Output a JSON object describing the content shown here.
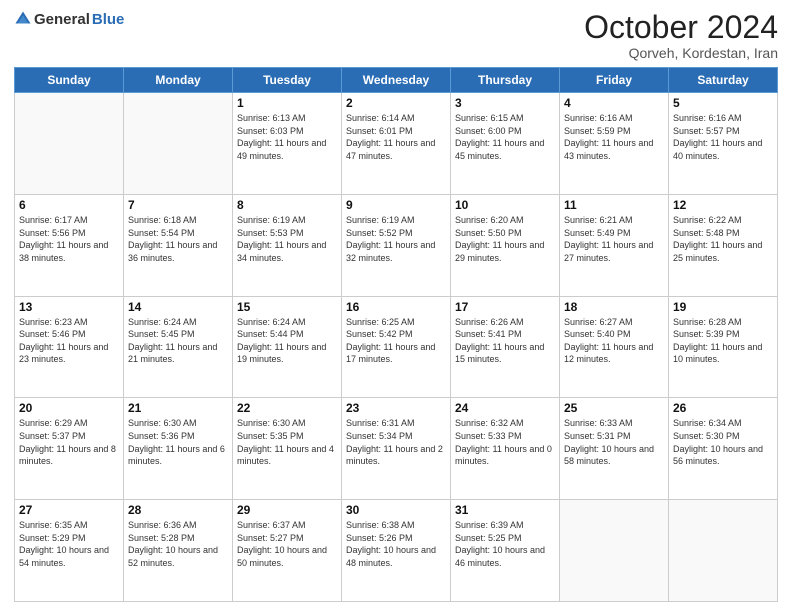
{
  "header": {
    "logo_general": "General",
    "logo_blue": "Blue",
    "title": "October 2024",
    "subtitle": "Qorveh, Kordestan, Iran"
  },
  "days_of_week": [
    "Sunday",
    "Monday",
    "Tuesday",
    "Wednesday",
    "Thursday",
    "Friday",
    "Saturday"
  ],
  "weeks": [
    [
      {
        "day": null,
        "info": null
      },
      {
        "day": null,
        "info": null
      },
      {
        "day": "1",
        "info": "Sunrise: 6:13 AM\nSunset: 6:03 PM\nDaylight: 11 hours and 49 minutes."
      },
      {
        "day": "2",
        "info": "Sunrise: 6:14 AM\nSunset: 6:01 PM\nDaylight: 11 hours and 47 minutes."
      },
      {
        "day": "3",
        "info": "Sunrise: 6:15 AM\nSunset: 6:00 PM\nDaylight: 11 hours and 45 minutes."
      },
      {
        "day": "4",
        "info": "Sunrise: 6:16 AM\nSunset: 5:59 PM\nDaylight: 11 hours and 43 minutes."
      },
      {
        "day": "5",
        "info": "Sunrise: 6:16 AM\nSunset: 5:57 PM\nDaylight: 11 hours and 40 minutes."
      }
    ],
    [
      {
        "day": "6",
        "info": "Sunrise: 6:17 AM\nSunset: 5:56 PM\nDaylight: 11 hours and 38 minutes."
      },
      {
        "day": "7",
        "info": "Sunrise: 6:18 AM\nSunset: 5:54 PM\nDaylight: 11 hours and 36 minutes."
      },
      {
        "day": "8",
        "info": "Sunrise: 6:19 AM\nSunset: 5:53 PM\nDaylight: 11 hours and 34 minutes."
      },
      {
        "day": "9",
        "info": "Sunrise: 6:19 AM\nSunset: 5:52 PM\nDaylight: 11 hours and 32 minutes."
      },
      {
        "day": "10",
        "info": "Sunrise: 6:20 AM\nSunset: 5:50 PM\nDaylight: 11 hours and 29 minutes."
      },
      {
        "day": "11",
        "info": "Sunrise: 6:21 AM\nSunset: 5:49 PM\nDaylight: 11 hours and 27 minutes."
      },
      {
        "day": "12",
        "info": "Sunrise: 6:22 AM\nSunset: 5:48 PM\nDaylight: 11 hours and 25 minutes."
      }
    ],
    [
      {
        "day": "13",
        "info": "Sunrise: 6:23 AM\nSunset: 5:46 PM\nDaylight: 11 hours and 23 minutes."
      },
      {
        "day": "14",
        "info": "Sunrise: 6:24 AM\nSunset: 5:45 PM\nDaylight: 11 hours and 21 minutes."
      },
      {
        "day": "15",
        "info": "Sunrise: 6:24 AM\nSunset: 5:44 PM\nDaylight: 11 hours and 19 minutes."
      },
      {
        "day": "16",
        "info": "Sunrise: 6:25 AM\nSunset: 5:42 PM\nDaylight: 11 hours and 17 minutes."
      },
      {
        "day": "17",
        "info": "Sunrise: 6:26 AM\nSunset: 5:41 PM\nDaylight: 11 hours and 15 minutes."
      },
      {
        "day": "18",
        "info": "Sunrise: 6:27 AM\nSunset: 5:40 PM\nDaylight: 11 hours and 12 minutes."
      },
      {
        "day": "19",
        "info": "Sunrise: 6:28 AM\nSunset: 5:39 PM\nDaylight: 11 hours and 10 minutes."
      }
    ],
    [
      {
        "day": "20",
        "info": "Sunrise: 6:29 AM\nSunset: 5:37 PM\nDaylight: 11 hours and 8 minutes."
      },
      {
        "day": "21",
        "info": "Sunrise: 6:30 AM\nSunset: 5:36 PM\nDaylight: 11 hours and 6 minutes."
      },
      {
        "day": "22",
        "info": "Sunrise: 6:30 AM\nSunset: 5:35 PM\nDaylight: 11 hours and 4 minutes."
      },
      {
        "day": "23",
        "info": "Sunrise: 6:31 AM\nSunset: 5:34 PM\nDaylight: 11 hours and 2 minutes."
      },
      {
        "day": "24",
        "info": "Sunrise: 6:32 AM\nSunset: 5:33 PM\nDaylight: 11 hours and 0 minutes."
      },
      {
        "day": "25",
        "info": "Sunrise: 6:33 AM\nSunset: 5:31 PM\nDaylight: 10 hours and 58 minutes."
      },
      {
        "day": "26",
        "info": "Sunrise: 6:34 AM\nSunset: 5:30 PM\nDaylight: 10 hours and 56 minutes."
      }
    ],
    [
      {
        "day": "27",
        "info": "Sunrise: 6:35 AM\nSunset: 5:29 PM\nDaylight: 10 hours and 54 minutes."
      },
      {
        "day": "28",
        "info": "Sunrise: 6:36 AM\nSunset: 5:28 PM\nDaylight: 10 hours and 52 minutes."
      },
      {
        "day": "29",
        "info": "Sunrise: 6:37 AM\nSunset: 5:27 PM\nDaylight: 10 hours and 50 minutes."
      },
      {
        "day": "30",
        "info": "Sunrise: 6:38 AM\nSunset: 5:26 PM\nDaylight: 10 hours and 48 minutes."
      },
      {
        "day": "31",
        "info": "Sunrise: 6:39 AM\nSunset: 5:25 PM\nDaylight: 10 hours and 46 minutes."
      },
      {
        "day": null,
        "info": null
      },
      {
        "day": null,
        "info": null
      }
    ]
  ]
}
